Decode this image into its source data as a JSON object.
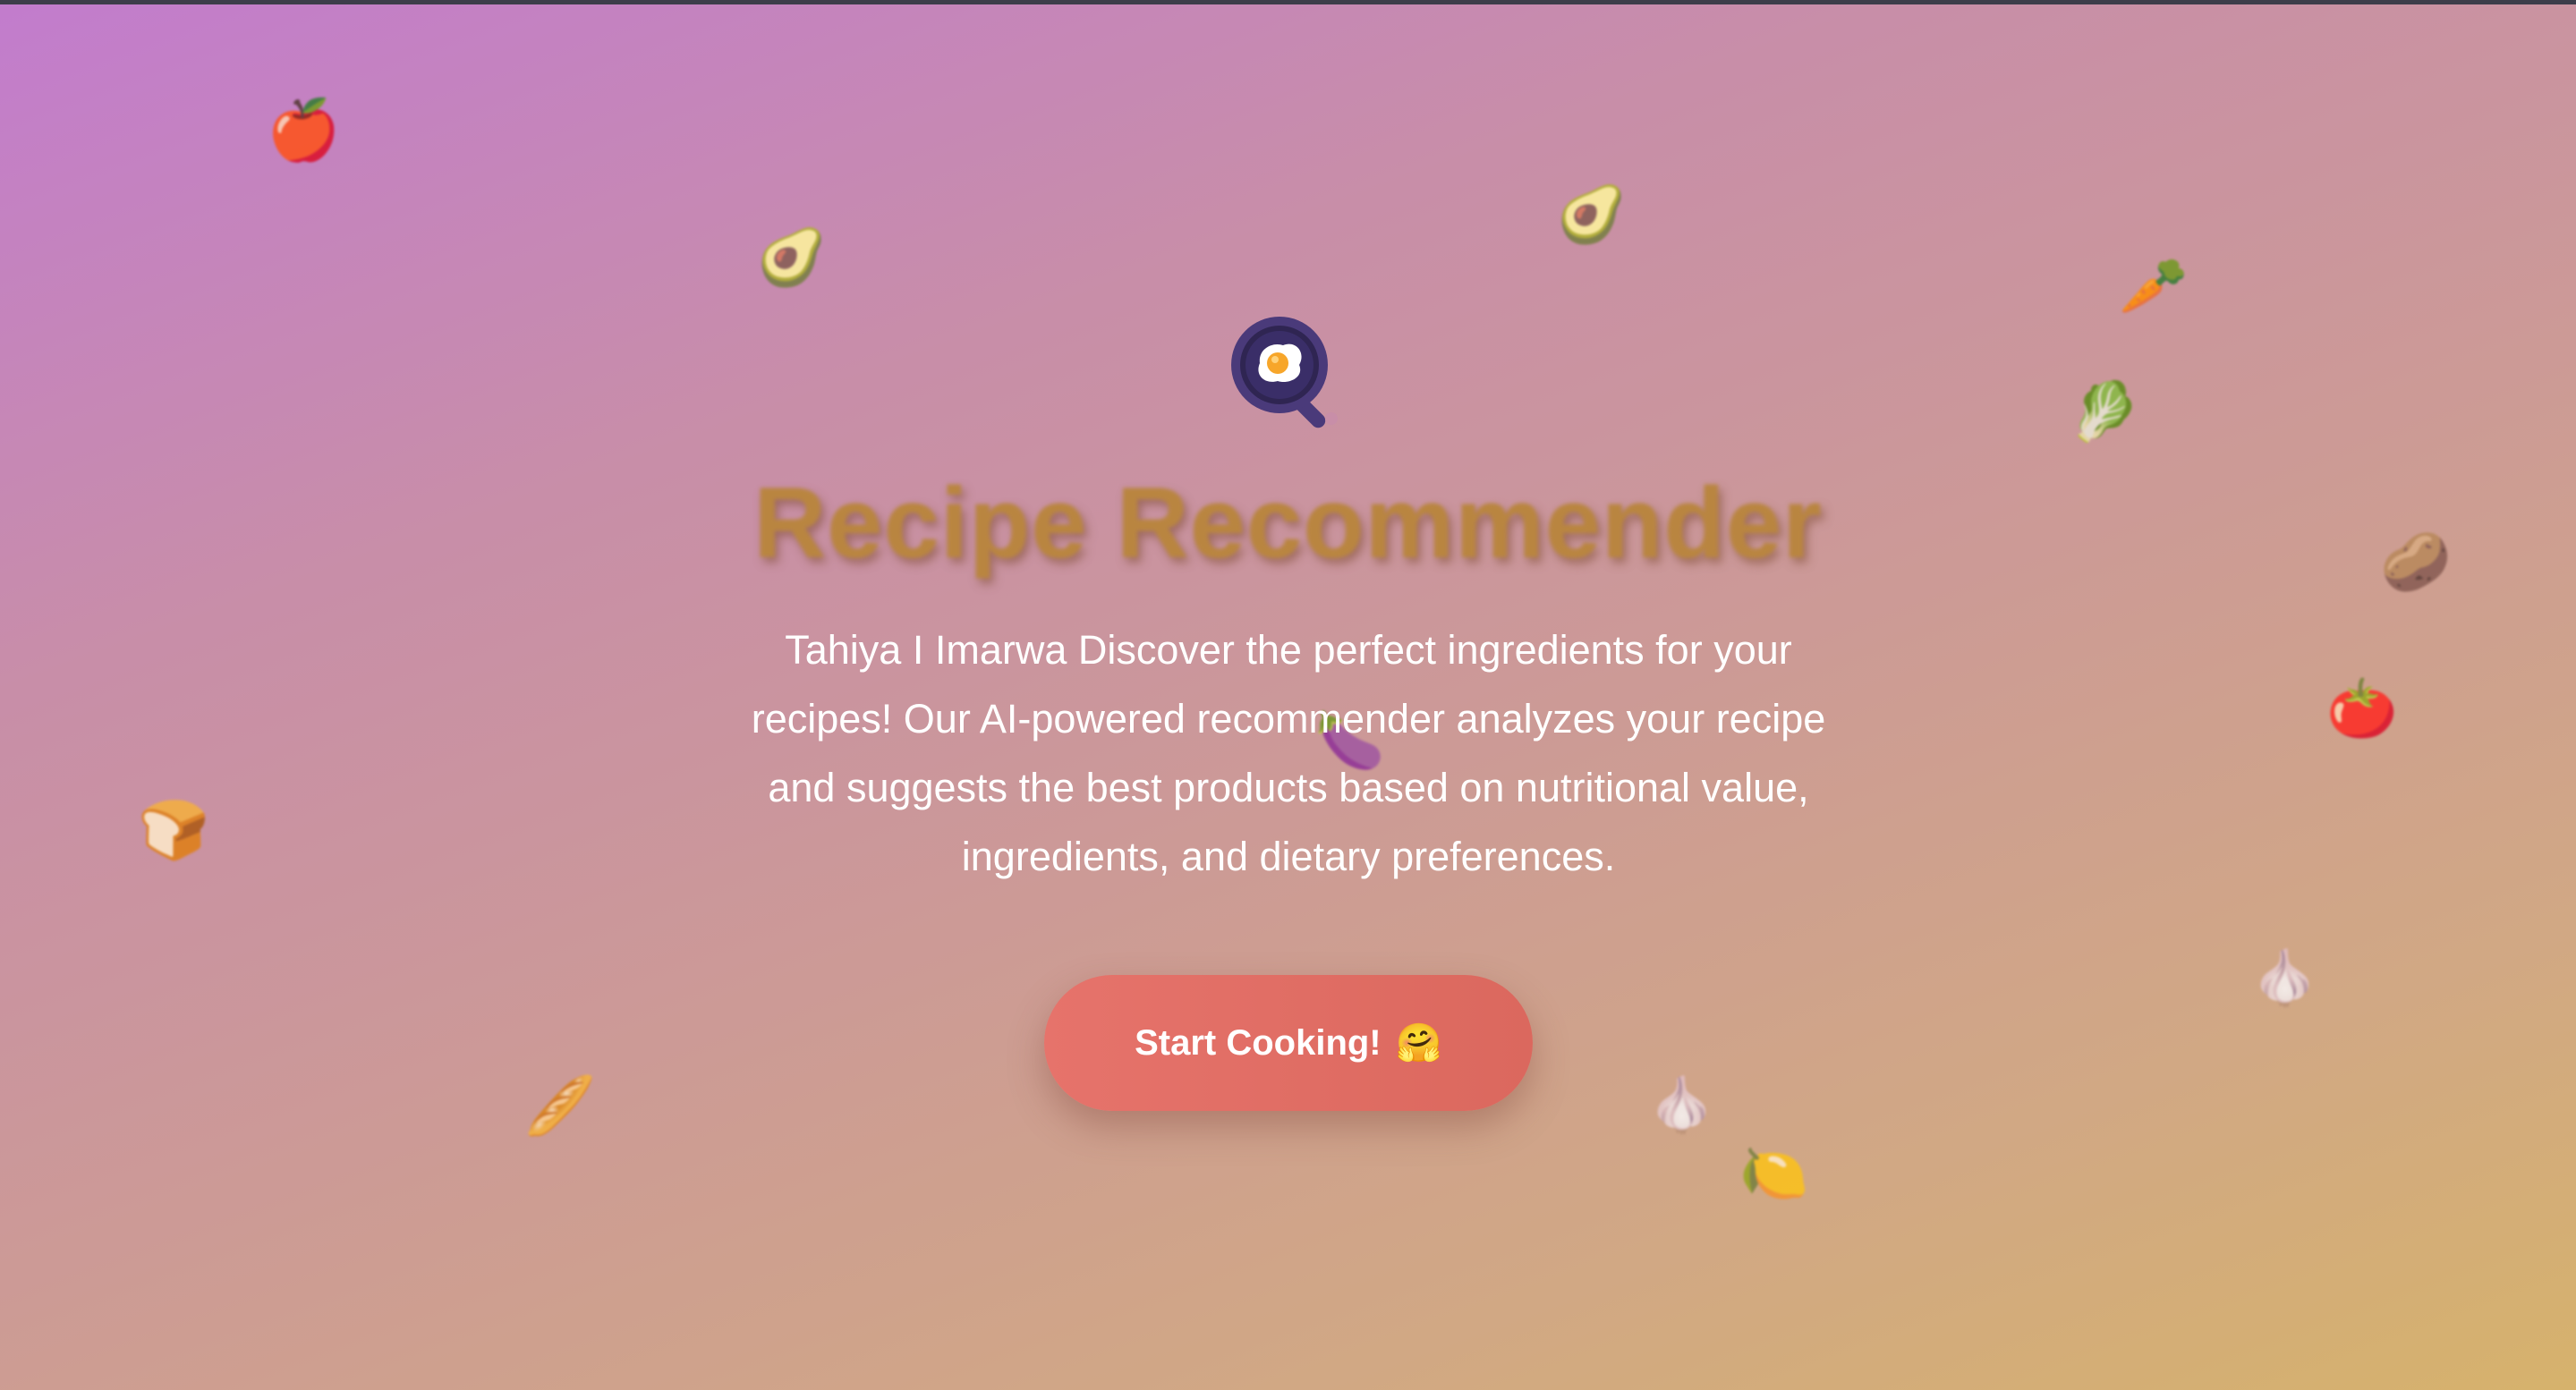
{
  "hero": {
    "logo_icon": "frying-pan-egg-icon",
    "title": "Recipe Recommender",
    "description": "Tahiya I Imarwa Discover the perfect ingredients for your recipes! Our AI-powered recommender analyzes your recipe and suggests the best products based on nutritional value, ingredients, and dietary preferences.",
    "cta_label": "Start Cooking!",
    "cta_emoji": "🤗"
  },
  "floating_items": [
    {
      "name": "apple-icon",
      "glyph": "🍎"
    },
    {
      "name": "avocado-icon",
      "glyph": "🥑"
    },
    {
      "name": "avocado-icon",
      "glyph": "🥑"
    },
    {
      "name": "carrot-icon",
      "glyph": "🥕"
    },
    {
      "name": "lettuce-icon",
      "glyph": "🥬"
    },
    {
      "name": "potato-icon",
      "glyph": "🥔"
    },
    {
      "name": "tomato-icon",
      "glyph": "🍅"
    },
    {
      "name": "eggplant-icon",
      "glyph": "🍆"
    },
    {
      "name": "bread-icon",
      "glyph": "🍞"
    },
    {
      "name": "baguette-icon",
      "glyph": "🥖"
    },
    {
      "name": "garlic-icon",
      "glyph": "🧄"
    },
    {
      "name": "garlic-icon",
      "glyph": "🧄"
    },
    {
      "name": "lemon-icon",
      "glyph": "🍋"
    }
  ],
  "colors": {
    "background_start": "#c27ccd",
    "background_end": "#d6b26c",
    "title": "#b98540",
    "cta": "#e06e64",
    "pan": "#4a3a7a"
  }
}
